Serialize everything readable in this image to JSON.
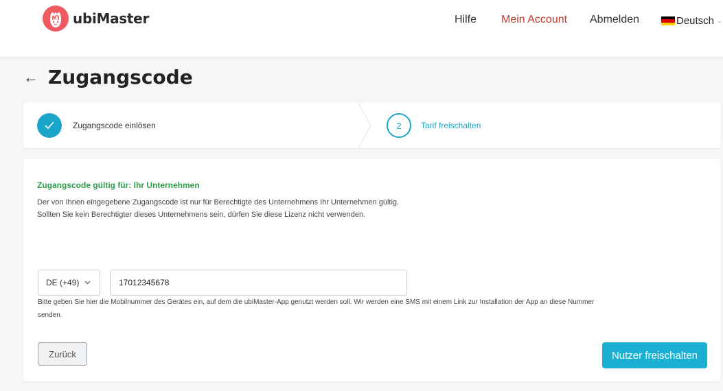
{
  "header": {
    "brand": "ubiMaster",
    "nav": {
      "help": "Hilfe",
      "account": "Mein Account",
      "logout": "Abmelden"
    },
    "language": "Deutsch",
    "colors": {
      "logo": "#ee5a5f",
      "account_link": "#c0392b"
    }
  },
  "page": {
    "title": "Zugangscode"
  },
  "stepper": {
    "steps": [
      {
        "label": "Zugangscode einlösen",
        "state": "done",
        "icon": "check-icon"
      },
      {
        "number": "2",
        "label": "Tarif freischalten",
        "state": "active"
      }
    ],
    "accent": "#1ba5c8"
  },
  "main": {
    "valid_title": "Zugangscode gültig für: Ihr Unternehmen",
    "valid_line1": "Der von Ihnen eingegebene Zugangscode ist nur für Berechtigte des Unternehmens Ihr Unternehmen gültig.",
    "valid_line2": "Sollten Sie kein Berechtigter dieses Unternehmens sein, dürfen Sie diese Lizenz nicht verwenden.",
    "country_code": "DE (+49)",
    "phone_value": "17012345678",
    "help_line1": "Bitte geben Sie hier die Mobilnummer des Gerätes ein, auf dem die ubiMaster-App genutzt werden soll. Wir werden eine SMS mit einem Link zur Installation der App an diese Nummer",
    "help_line2": "senden.",
    "back_label": "Zurück",
    "submit_label": "Nutzer freischalten"
  }
}
